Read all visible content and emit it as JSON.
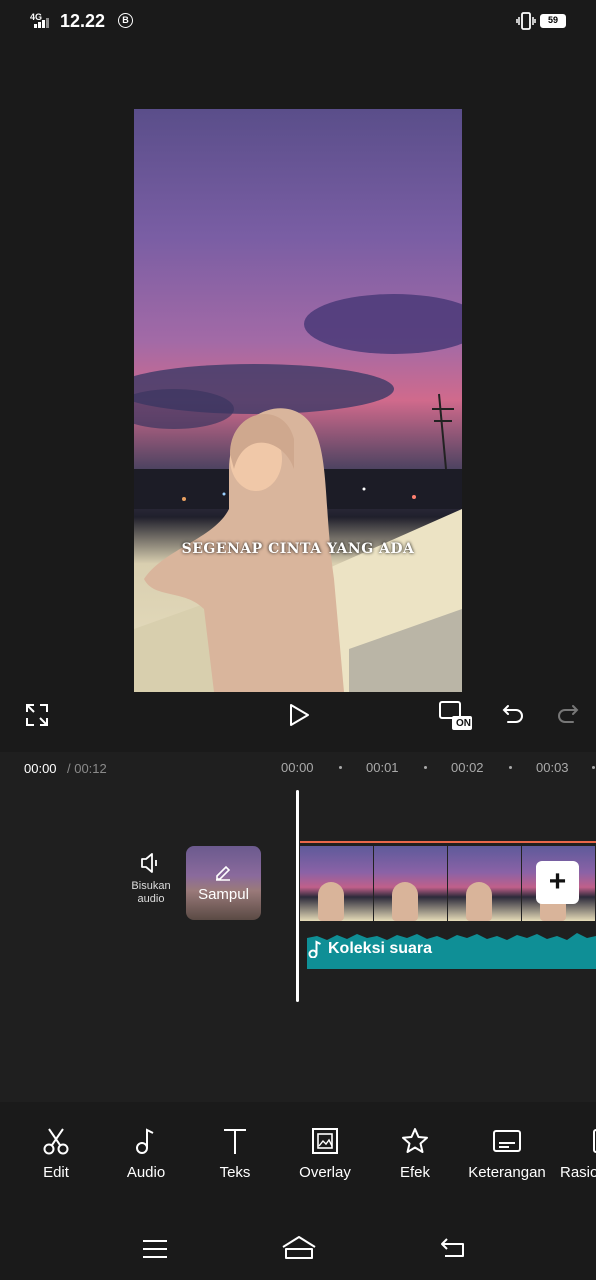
{
  "status_bar": {
    "network": "4G",
    "time": "12.22",
    "notification_badge": "B",
    "battery": "59"
  },
  "preview": {
    "caption": "SEGENAP CINTA YANG ADA"
  },
  "controls": {
    "fullscreen_icon": "fullscreen-icon",
    "play_icon": "play-icon",
    "on_label": "ON",
    "undo_icon": "undo-icon",
    "redo_icon": "redo-icon"
  },
  "timeline": {
    "current_time": "00:00",
    "total_time": "/ 00:12",
    "ruler": [
      "00:00",
      "00:01",
      "00:02",
      "00:03"
    ],
    "mute_label_line1": "Bisukan",
    "mute_label_line2": "audio",
    "cover_label": "Sampul",
    "add_label": "+",
    "audio_track_label": "Koleksi suara"
  },
  "toolbar": {
    "items": [
      {
        "label": "Edit",
        "icon": "scissors-icon"
      },
      {
        "label": "Audio",
        "icon": "music-note-icon"
      },
      {
        "label": "Teks",
        "icon": "text-icon"
      },
      {
        "label": "Overlay",
        "icon": "overlay-icon"
      },
      {
        "label": "Efek",
        "icon": "star-icon"
      },
      {
        "label": "Keterangan",
        "icon": "captions-icon"
      },
      {
        "label": "Rasio",
        "icon": "ratio-icon"
      }
    ]
  },
  "navbar": {
    "menu_icon": "menu-icon",
    "home_icon": "home-icon",
    "back_icon": "back-icon"
  },
  "colors": {
    "background": "#1a1a1a",
    "timeline_bg": "#1f1f1f",
    "audio_track": "#0f8f96",
    "clip_border": "#e8674a"
  }
}
